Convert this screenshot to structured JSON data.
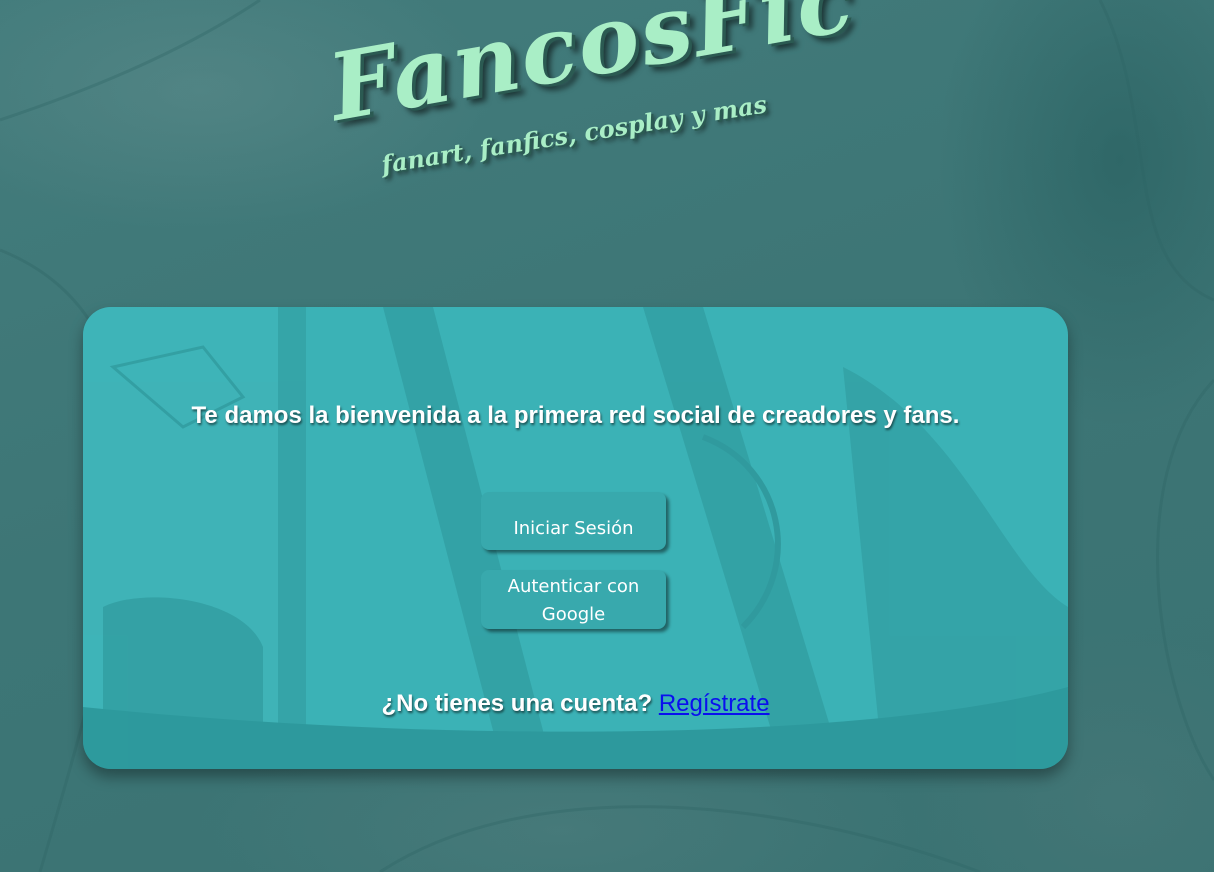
{
  "brand": {
    "name": "FancosFic",
    "tagline": "fanart, fanfics, cosplay y mas"
  },
  "welcome": {
    "message": "Te damos la bienvenida a la primera red social de creadores y fans."
  },
  "actions": {
    "login_label": "Iniciar Sesión",
    "google_label": "Autenticar con Google"
  },
  "signup": {
    "prompt": "¿No tienes una cuenta?",
    "link_label": "Regístrate"
  },
  "colors": {
    "background": "#3c7575",
    "card": "#3bb2b6",
    "button": "#38a9ad",
    "logo_text": "#a9eec6",
    "link": "#0a10ee"
  }
}
